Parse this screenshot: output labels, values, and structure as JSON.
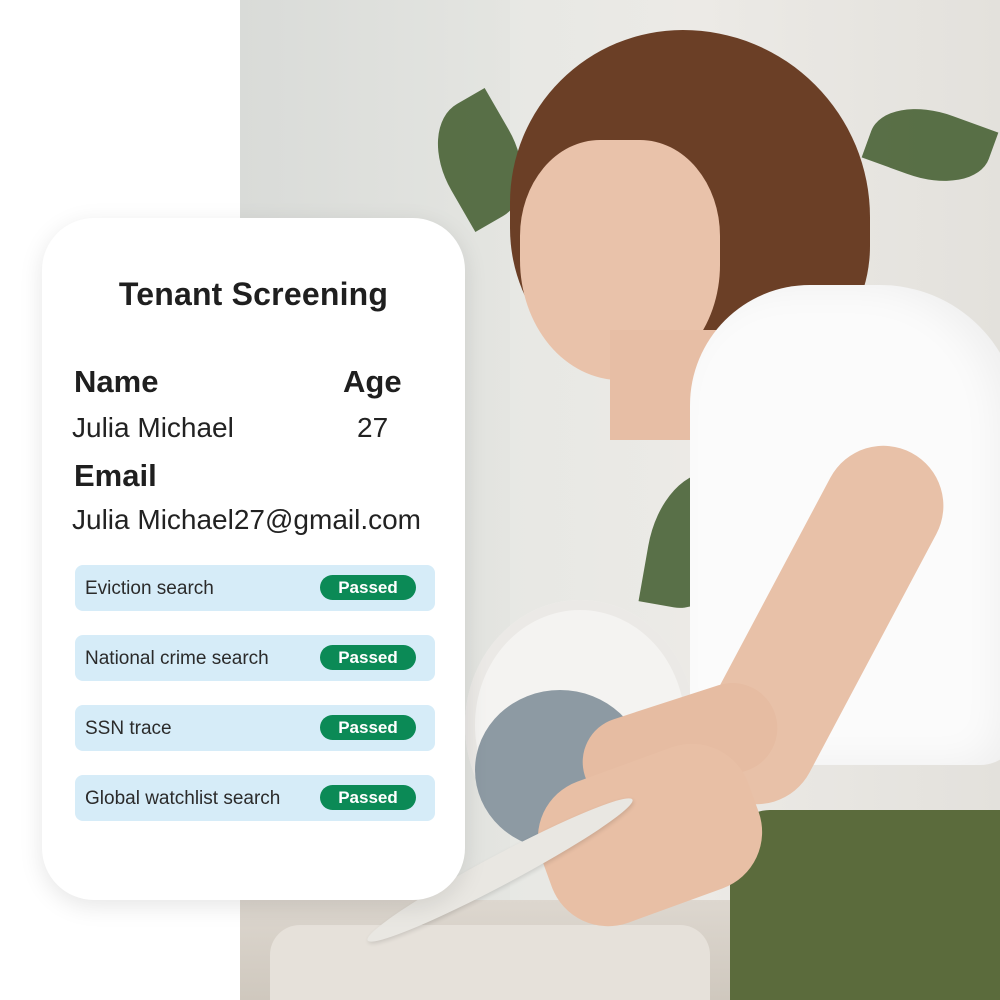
{
  "card": {
    "title": "Tenant Screening",
    "name_label": "Name",
    "name_value": "Julia Michael",
    "age_label": "Age",
    "age_value": "27",
    "email_label": "Email",
    "email_value": "Julia Michael27@gmail.com"
  },
  "checks": [
    {
      "label": "Eviction search",
      "status": "Passed"
    },
    {
      "label": "National crime search",
      "status": "Passed"
    },
    {
      "label": "SSN trace",
      "status": "Passed"
    },
    {
      "label": "Global watchlist search",
      "status": "Passed"
    }
  ],
  "colors": {
    "status_passed": "#0b8a56",
    "check_row_bg": "#d6ecf8"
  }
}
